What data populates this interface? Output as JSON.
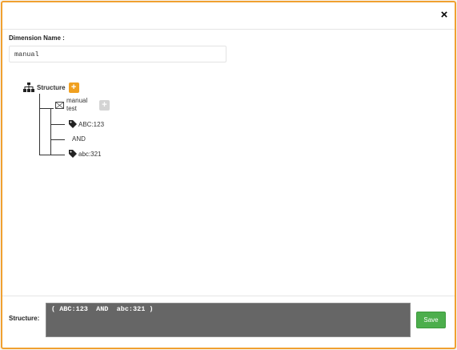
{
  "dialog": {
    "close_icon": "×"
  },
  "dimension": {
    "label": "Dimension Name :",
    "value": "manual"
  },
  "tree": {
    "root": {
      "icon": "sitemap-icon",
      "label": "Structure",
      "add_icon": "+"
    },
    "group": {
      "icon": "group-icon",
      "label": "manual test",
      "add_icon": "+"
    },
    "items": [
      {
        "kind": "condition",
        "icon": "tag-icon",
        "label": "ABC:123"
      },
      {
        "kind": "operator",
        "label": "AND"
      },
      {
        "kind": "condition",
        "icon": "tag-icon",
        "label": "abc:321"
      }
    ]
  },
  "footer": {
    "structure_label": "Structure:",
    "structure_value": "( ABC:123  AND  abc:321 )",
    "save_label": "Save"
  },
  "colors": {
    "accent_border": "#f0a030",
    "add_button": "#f0a020",
    "add_button_disabled": "#d4d4d4",
    "save_button": "#4cae4c",
    "structure_box": "#666666"
  }
}
